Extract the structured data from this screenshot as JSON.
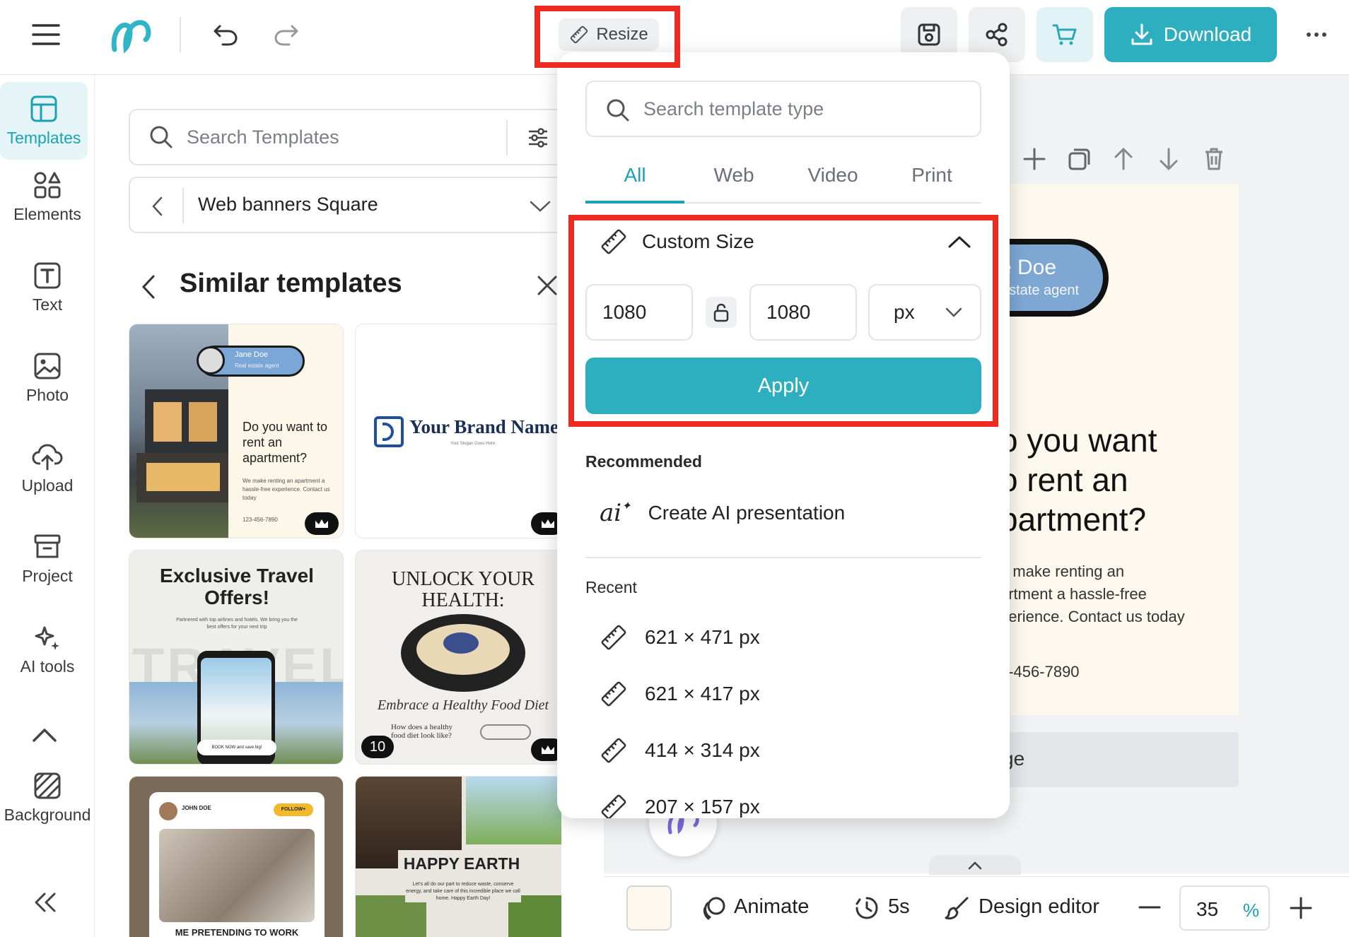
{
  "toolbar": {
    "resize_label": "Resize",
    "download_label": "Download"
  },
  "sidebar": {
    "items": [
      {
        "label": "Templates",
        "icon": "layout-icon"
      },
      {
        "label": "Elements",
        "icon": "shapes-icon"
      },
      {
        "label": "Text",
        "icon": "text-icon"
      },
      {
        "label": "Photo",
        "icon": "image-icon"
      },
      {
        "label": "Upload",
        "icon": "upload-cloud-icon"
      },
      {
        "label": "Project",
        "icon": "archive-icon"
      },
      {
        "label": "AI tools",
        "icon": "sparkle-icon"
      },
      {
        "label": "Background",
        "icon": "hatch-icon"
      }
    ]
  },
  "panel": {
    "search_placeholder": "Search Templates",
    "category": "Web banners Square",
    "section_title": "Similar templates"
  },
  "templates": {
    "t1": {
      "name": "Jane Doe",
      "role": "Real estate agent",
      "headline": "Do you want to rent an apartment?",
      "body": "We make renting an apartment a hassle-free experience. Contact us today",
      "phone": "123-456-7890"
    },
    "t2": {
      "brand": "Your Brand Name",
      "slogan": "Your Slogan Goes Here"
    },
    "t3": {
      "headline": "Exclusive Travel Offers!",
      "sub": "Partnered with top airlines and hotels. We bring you the best offers for your next trip",
      "bg_word": "TRAVEL",
      "cta": "BOOK NOW and save big!"
    },
    "t4": {
      "headline": "UNLOCK YOUR HEALTH:",
      "sub": "Embrace a Healthy Food Diet",
      "q": "How does a healthy food diet look like?",
      "count": "10"
    },
    "t5": {
      "name": "JOHN DOE",
      "follow": "FOLLOW+",
      "caption": "ME PRETENDING TO WORK WHILE ACTUALLY"
    },
    "t6": {
      "headline": "HAPPY EARTH DAY",
      "body": "Let's all do our part to reduce waste, conserve energy, and take care of this incredible place we call home. Happy Earth Day!"
    }
  },
  "popup": {
    "search_placeholder": "Search template type",
    "tabs": [
      "All",
      "Web",
      "Video",
      "Print"
    ],
    "custom_size_label": "Custom Size",
    "width": "1080",
    "height": "1080",
    "unit": "px",
    "apply_label": "Apply",
    "recommended_label": "Recommended",
    "ai_label": "Create AI presentation",
    "recent_label": "Recent",
    "recent": [
      "621 × 471 px",
      "621 × 417 px",
      "414 × 314 px",
      "207 × 157 px"
    ]
  },
  "design": {
    "name_partial": "e Doe",
    "role_partial": "estate agent",
    "line1": "o you want",
    "line2": "o rent an",
    "line3": "partment?",
    "body1": "e make renting an",
    "body2": "artment a hassle-free",
    "body3": "perience. Contact us today",
    "phone": "3-456-7890",
    "page_partial": "ge"
  },
  "bottombar": {
    "animate_label": "Animate",
    "duration": "5s",
    "design_editor_label": "Design editor",
    "zoom_value": "35",
    "zoom_unit": "%"
  },
  "colors": {
    "accent": "#2eafc0",
    "highlight": "#ef2a21"
  }
}
